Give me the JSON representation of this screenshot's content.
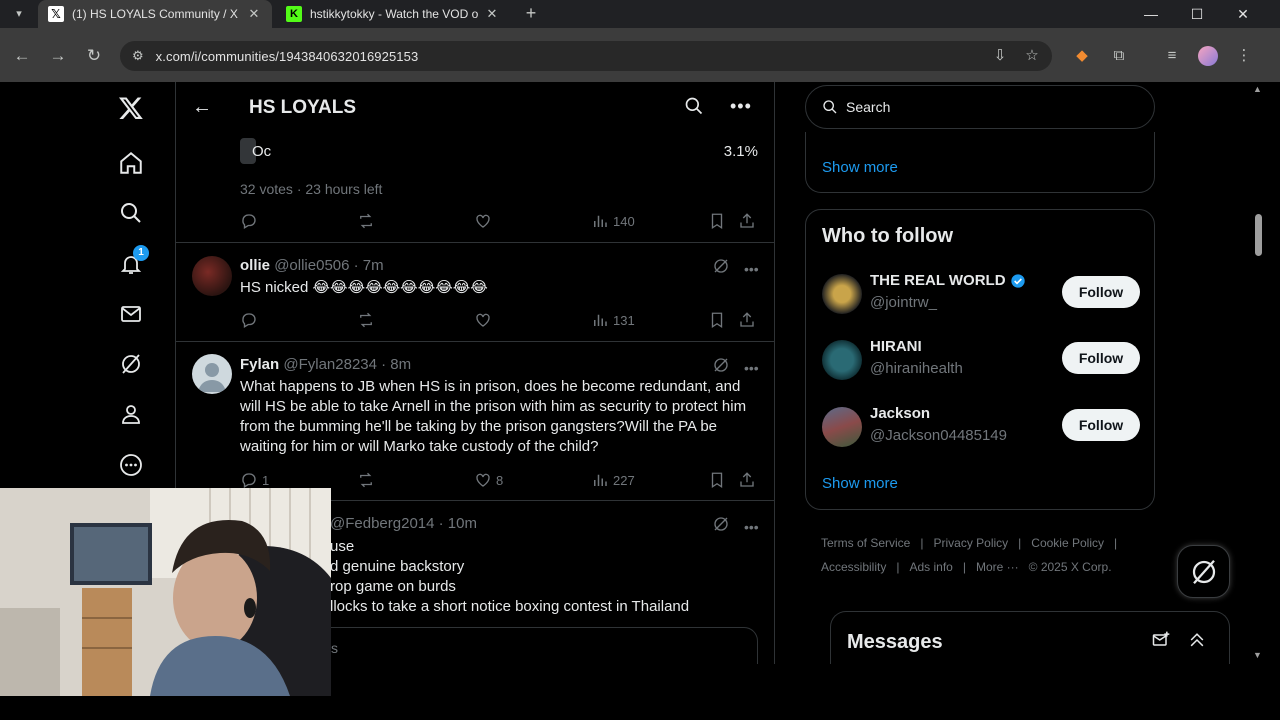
{
  "browser": {
    "tabs": [
      {
        "title": "(1) HS LOYALS Community / X",
        "favicon": "x-logo-icon",
        "active": true
      },
      {
        "title": "hstikkytokky - Watch the VOD o",
        "favicon": "kick-logo-icon",
        "active": false
      }
    ],
    "url": "x.com/i/communities/1943840632016925153"
  },
  "header": {
    "title": "HS LOYALS"
  },
  "poll": {
    "option_label": "Oc",
    "option_percent": "3.1%",
    "meta": "32 votes · 23 hours left",
    "views": "140"
  },
  "posts": [
    {
      "name": "ollie",
      "handle_time": "@ollie0506 · 7m",
      "text": "HS nicked 😂😂😂😂😂😂😂😂😂😂",
      "replies": "",
      "likes": "",
      "views": "131"
    },
    {
      "name": "Fylan",
      "handle_time": "@Fylan28234 · 8m",
      "text": "What happens to JB when HS is in prison, does he become redundant, and will HS be able to take Arnell in the prison with him as security to protect him from the bumming he'll be taking by the prison gangsters?Will the PA be waiting for him or will Marko take custody of the child?",
      "replies": "1",
      "likes": "8",
      "views": "227"
    },
    {
      "name": "",
      "handle_time": "@Fedberg2014 · 10m",
      "lines": [
        "use",
        "d genuine backstory",
        "rop game on burds",
        "llocks to take a short notice boxing contest in Thailand"
      ],
      "quote_fragment": "s"
    }
  ],
  "sidebar": {
    "search_placeholder": "Search",
    "show_more_top": "Show more",
    "who_to_follow_title": "Who to follow",
    "suggestions": [
      {
        "name": "THE REAL WORLD",
        "handle": "@jointrw_",
        "verified": true,
        "button": "Follow"
      },
      {
        "name": "HIRANI",
        "handle": "@hiranihealth",
        "verified": false,
        "button": "Follow"
      },
      {
        "name": "Jackson",
        "handle": "@Jackson04485149",
        "verified": false,
        "button": "Follow"
      }
    ],
    "show_more_bottom": "Show more",
    "footer": [
      "Terms of Service",
      "|",
      "Privacy Policy",
      "|",
      "Cookie Policy",
      "|",
      "Accessibility",
      "|",
      "Ads info",
      "|",
      "More ···",
      "© 2025 X Corp."
    ]
  },
  "notifications_badge": "1",
  "messages": {
    "title": "Messages"
  },
  "colors": {
    "accent": "#1d9bf0",
    "background": "#000000",
    "border": "#2f3336",
    "muted_text": "#71767b"
  }
}
